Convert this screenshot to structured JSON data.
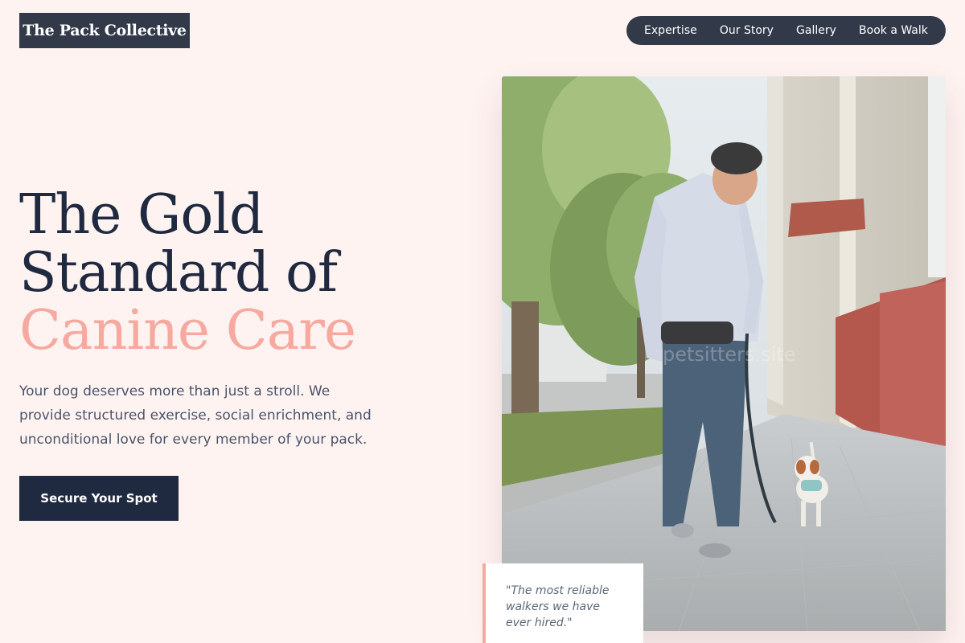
{
  "brand": {
    "name": "The Pack Collective"
  },
  "nav": {
    "items": [
      {
        "label": "Expertise"
      },
      {
        "label": "Our Story"
      },
      {
        "label": "Gallery"
      },
      {
        "label": "Book a Walk"
      }
    ]
  },
  "hero": {
    "title_line1": "The Gold",
    "title_line2": "Standard of",
    "title_accent": "Canine Care",
    "description": "Your dog deserves more than just a stroll. We provide structured exercise, social enrichment, and unconditional love for every member of your pack.",
    "cta_label": "Secure Your Spot"
  },
  "photo": {
    "alt": "Man walking a small dog on a leash along a city sidewalk",
    "watermark": "petsitters.site"
  },
  "testimonial": {
    "quote": "\"The most reliable walkers we have ever hired.\""
  },
  "colors": {
    "background": "#fff3f2",
    "navy": "#1f2940",
    "slate": "#323a4a",
    "accent": "#f7a9a0"
  }
}
